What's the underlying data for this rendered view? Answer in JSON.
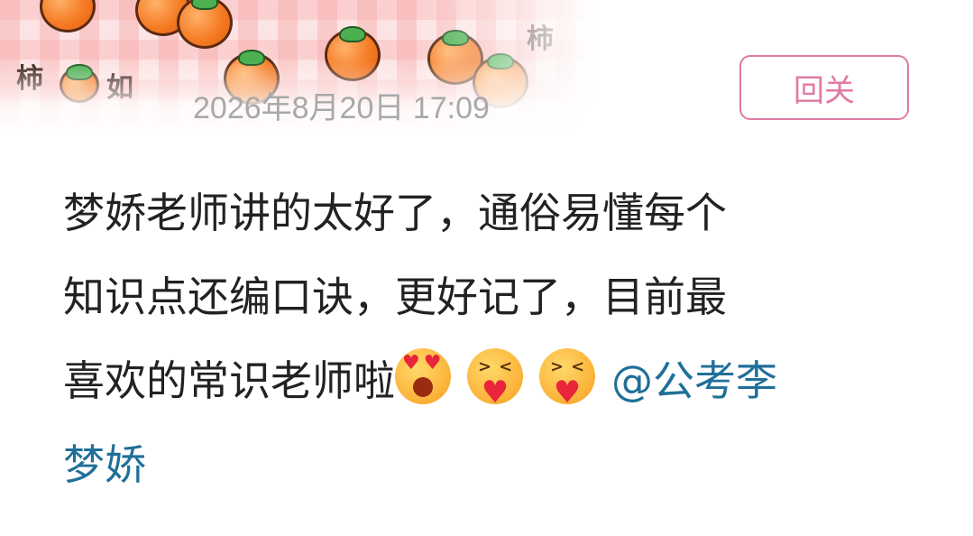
{
  "banner": {
    "word_left": "柿",
    "word_mid": "如",
    "word_right": "柿"
  },
  "post": {
    "timestamp": "2026年8月20日 17:09",
    "follow_label": "回关",
    "text_line1": "梦娇老师讲的太好了，通俗易懂每个",
    "text_line2": "知识点还编口诀，更好记了，目前最",
    "text_line3_prefix": "喜欢的常识老师啦",
    "emojis": [
      "heart-eyes-emoji",
      "hug-emoji",
      "hug-emoji"
    ],
    "mention_part1": "@公考李",
    "mention_part2": "梦娇"
  },
  "colors": {
    "timestamp": "#a8a8a8",
    "follow_border": "#e07aa4",
    "body_text": "#222222",
    "mention": "#1f6f99"
  }
}
